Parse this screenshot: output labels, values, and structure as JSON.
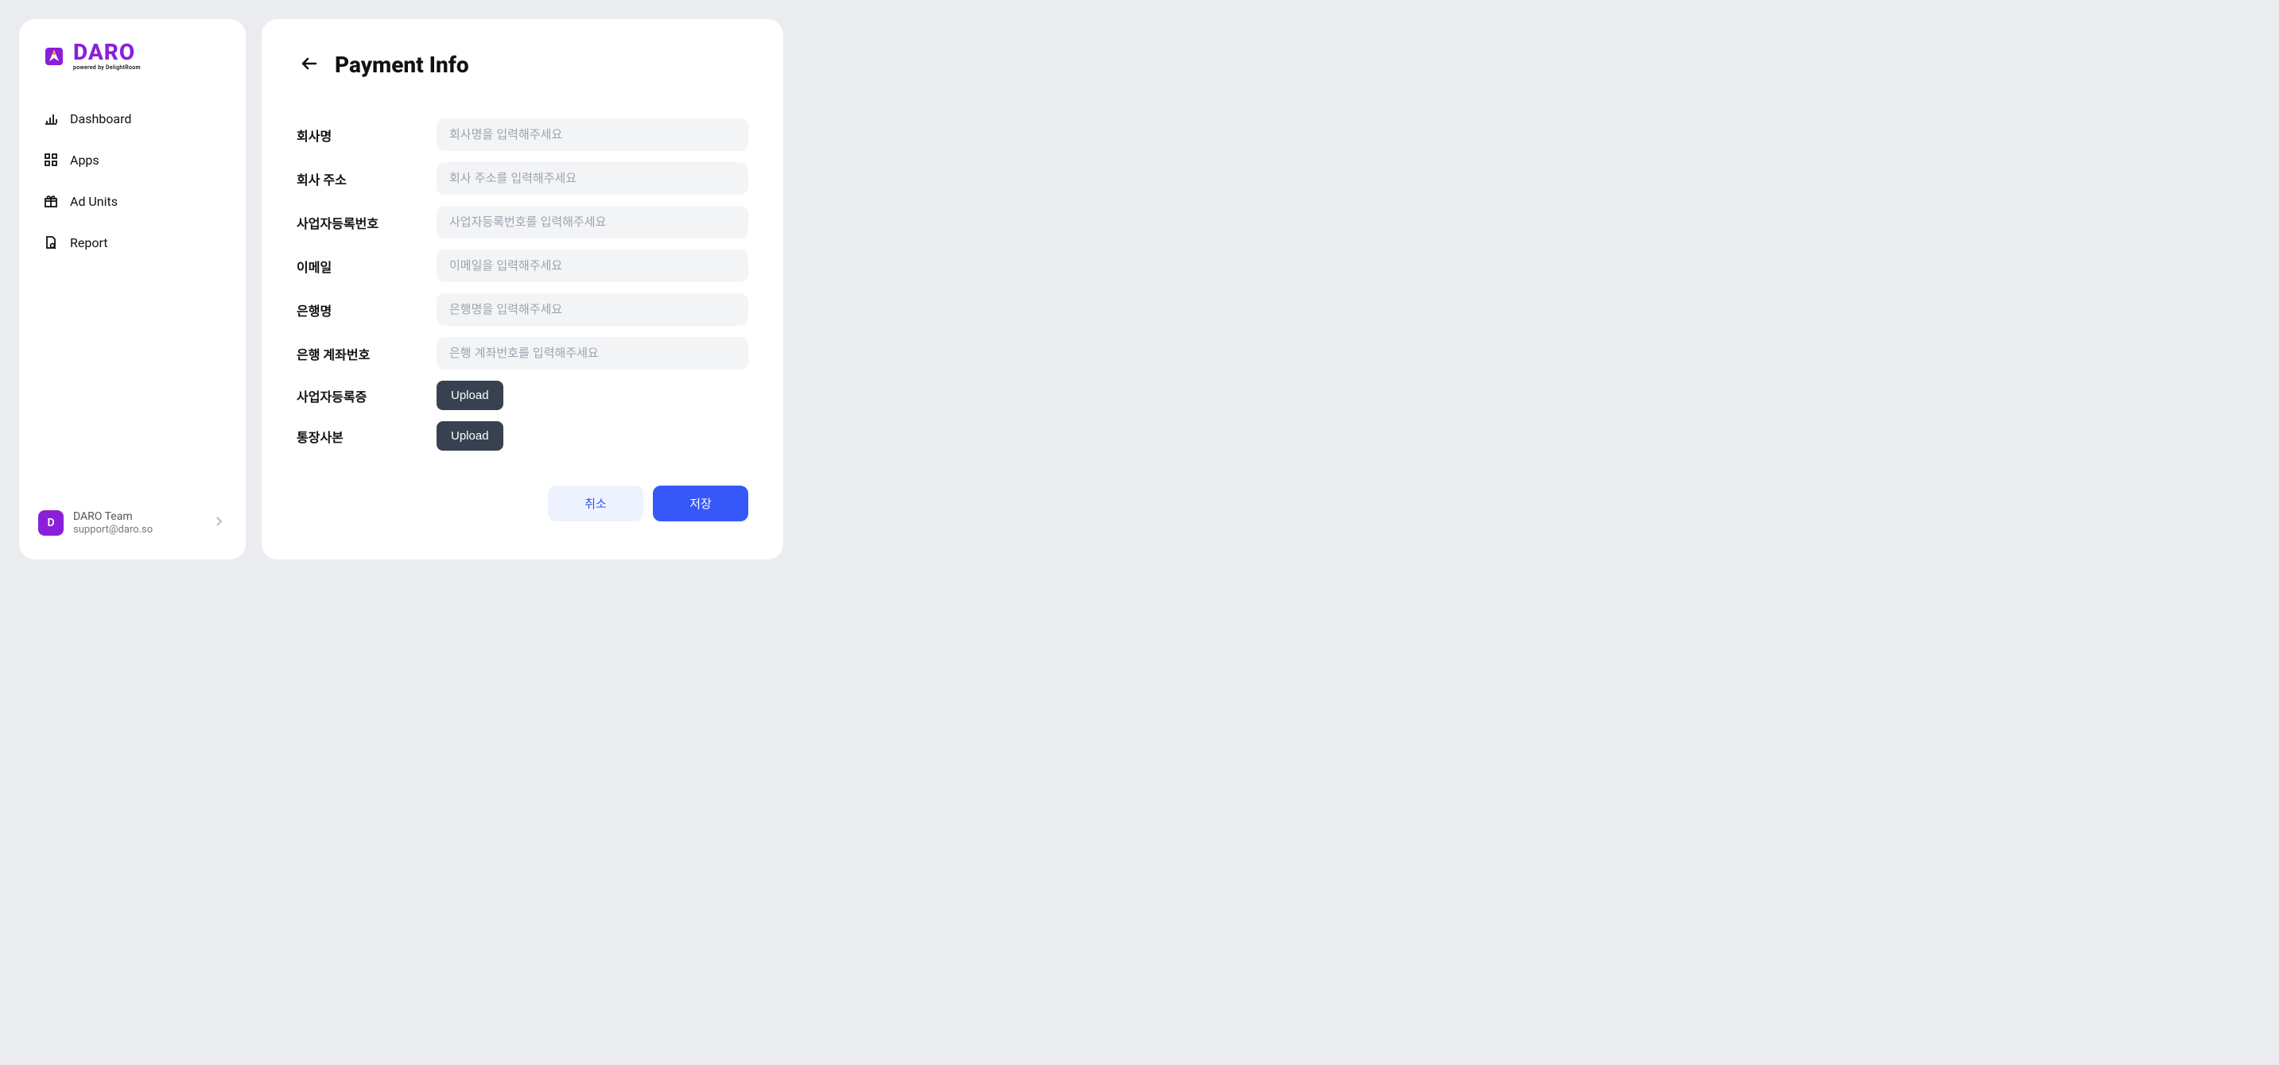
{
  "logo": {
    "name": "DARO",
    "tagline": "powered by DelightRoom"
  },
  "sidebar": {
    "items": [
      {
        "label": "Dashboard"
      },
      {
        "label": "Apps"
      },
      {
        "label": "Ad Units"
      },
      {
        "label": "Report"
      }
    ]
  },
  "user": {
    "name": "DARO Team",
    "email": "support@daro.so",
    "initial": "D"
  },
  "page": {
    "title": "Payment Info"
  },
  "form": {
    "fields": {
      "company_name": {
        "label": "회사명",
        "placeholder": "회사명을 입력해주세요",
        "value": ""
      },
      "company_address": {
        "label": "회사 주소",
        "placeholder": "회사 주소를 입력해주세요",
        "value": ""
      },
      "business_reg_no": {
        "label": "사업자등록번호",
        "placeholder": "사업자등록번호를 입력해주세요",
        "value": ""
      },
      "email": {
        "label": "이메일",
        "placeholder": "이메일을 입력해주세요",
        "value": ""
      },
      "bank_name": {
        "label": "은행명",
        "placeholder": "은행명을 입력해주세요",
        "value": ""
      },
      "bank_account": {
        "label": "은행 계좌번호",
        "placeholder": "은행 계좌번호를 입력해주세요",
        "value": ""
      },
      "business_cert": {
        "label": "사업자등록증",
        "button": "Upload"
      },
      "bankbook": {
        "label": "통장사본",
        "button": "Upload"
      }
    },
    "actions": {
      "cancel": "취소",
      "save": "저장"
    }
  }
}
